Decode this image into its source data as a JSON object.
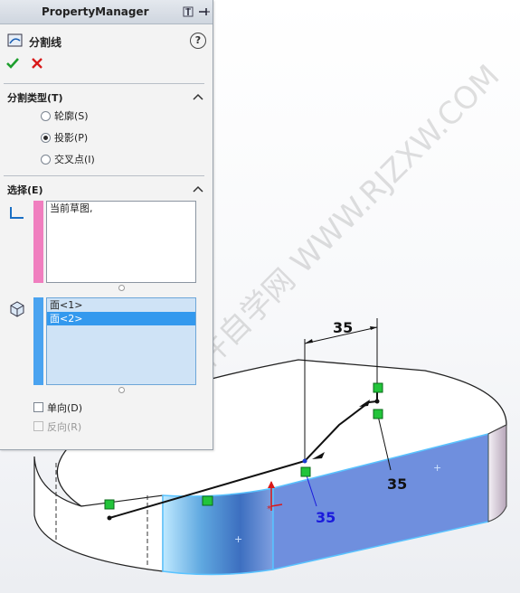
{
  "panel": {
    "title": "PropertyManager",
    "feature_title": "分割线",
    "help_label": "?"
  },
  "split_type": {
    "header": "分割类型(T)",
    "options": [
      {
        "label": "轮廓(S)",
        "selected": false
      },
      {
        "label": "投影(P)",
        "selected": true
      },
      {
        "label": "交叉点(I)",
        "selected": false
      }
    ]
  },
  "selection": {
    "header": "选择(E)",
    "sketch_list": [
      "当前草图,"
    ],
    "face_list": [
      {
        "label": "面<1>",
        "selected": false
      },
      {
        "label": "面<2>",
        "selected": true
      }
    ],
    "single_direction": {
      "label": "单向(D)",
      "checked": false,
      "enabled": true
    },
    "reverse": {
      "label": "反向(R)",
      "checked": false,
      "enabled": false
    }
  },
  "viewport": {
    "dimensions": [
      {
        "value": "35",
        "color": "#111111"
      },
      {
        "value": "35",
        "color": "#1a1adc"
      },
      {
        "value": "35",
        "color": "#111111"
      }
    ],
    "watermark": "软件自学网 WWW.RJZXW.COM"
  },
  "colors": {
    "sketch_bar": "#f07fbf",
    "face_bar": "#4aa3f0",
    "selected_face": "#6f8fde",
    "ok_green": "#1d9e2d",
    "cancel_red": "#d81919"
  },
  "icons": [
    "pin-icon",
    "split-line-icon",
    "help-icon",
    "ok-check-icon",
    "cancel-x-icon",
    "collapse-up-icon",
    "sketch-selection-icon",
    "face-selection-icon"
  ]
}
